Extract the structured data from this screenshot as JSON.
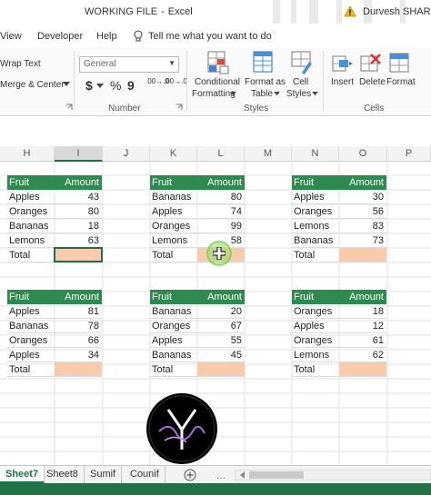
{
  "window": {
    "file_name": "WORKING FILE",
    "separator": "-",
    "app_name": "Excel",
    "user_name": "Durvesh SHARMA"
  },
  "menu": {
    "items": [
      "View",
      "Developer",
      "Help"
    ],
    "tell_me": "Tell me what you want to do"
  },
  "ribbon": {
    "alignment": {
      "wrap_text": "Wrap Text",
      "merge_center": "Merge & Center"
    },
    "number": {
      "format_value": "General",
      "currency_symbol": "$",
      "percent_symbol": "%",
      "comma_symbol": "9",
      "increase_decimal": ".00→.0",
      "decrease_decimal": ".00→.0",
      "group_label": "Number"
    },
    "styles": {
      "conditional_formatting": [
        "Conditional",
        "Formatting"
      ],
      "format_as_table": [
        "Format as",
        "Table"
      ],
      "cell_styles": [
        "Cell",
        "Styles"
      ],
      "group_label": "Styles"
    },
    "cells": {
      "insert": "Insert",
      "delete": "Delete",
      "format": "Format",
      "group_label": "Cells"
    }
  },
  "grid": {
    "columns": [
      "H",
      "I",
      "J",
      "K",
      "L",
      "M",
      "N",
      "O",
      "P"
    ],
    "active_column": "I"
  },
  "tables": [
    {
      "header": [
        "Fruit",
        "Amount"
      ],
      "rows": [
        [
          "Apples",
          "43"
        ],
        [
          "Oranges",
          "80"
        ],
        [
          "Bananas",
          "18"
        ],
        [
          "Lemons",
          "63"
        ]
      ],
      "total_label": "Total",
      "selected": true
    },
    {
      "header": [
        "Fruit",
        "Amount"
      ],
      "rows": [
        [
          "Bananas",
          "80"
        ],
        [
          "Apples",
          "74"
        ],
        [
          "Oranges",
          "99"
        ],
        [
          "Lemons",
          "58"
        ]
      ],
      "total_label": "Total",
      "selected": false
    },
    {
      "header": [
        "Fruit",
        "Amount"
      ],
      "rows": [
        [
          "Apples",
          "30"
        ],
        [
          "Oranges",
          "56"
        ],
        [
          "Lemons",
          "83"
        ],
        [
          "Bananas",
          "73"
        ]
      ],
      "total_label": "Total",
      "selected": false
    },
    {
      "header": [
        "Fruit",
        "Amount"
      ],
      "rows": [
        [
          "Apples",
          "81"
        ],
        [
          "Bananas",
          "78"
        ],
        [
          "Oranges",
          "66"
        ],
        [
          "Apples",
          "34"
        ]
      ],
      "total_label": "Total",
      "selected": false
    },
    {
      "header": [
        "Fruit",
        "Amount"
      ],
      "rows": [
        [
          "Bananas",
          "20"
        ],
        [
          "Oranges",
          "67"
        ],
        [
          "Apples",
          "55"
        ],
        [
          "Bananas",
          "45"
        ]
      ],
      "total_label": "Total",
      "selected": false
    },
    {
      "header": [
        "Fruit",
        "Amount"
      ],
      "rows": [
        [
          "Oranges",
          "18"
        ],
        [
          "Apples",
          "12"
        ],
        [
          "Oranges",
          "61"
        ],
        [
          "Lemons",
          "62"
        ]
      ],
      "total_label": "Total",
      "selected": false
    }
  ],
  "sheets": {
    "tabs": [
      "Sheet7",
      "Sheet8",
      "Sumif",
      "Counif"
    ],
    "active": "Sheet7",
    "more": "..."
  },
  "colors": {
    "table_header": "#2f8a4f",
    "total_fill": "#f8cbad",
    "excel_green": "#217346"
  },
  "icons": {
    "warning": "warning-icon",
    "tell_me": "lightbulb-icon",
    "add_sheet": "plus-circle-icon",
    "cursor": "plus-cursor-icon"
  }
}
